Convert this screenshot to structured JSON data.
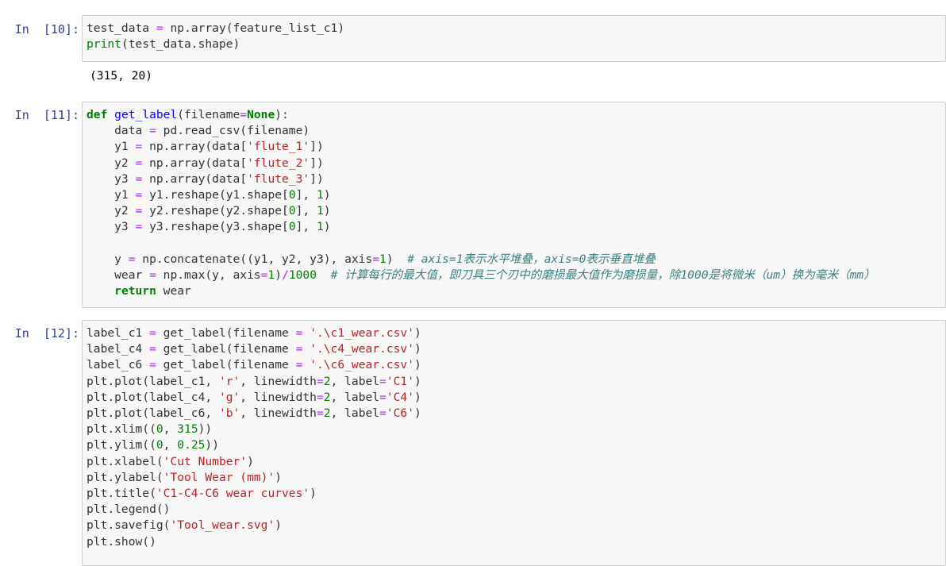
{
  "cells": [
    {
      "prompt": "In  [10]:",
      "lines": [
        [
          [
            "t",
            "test_data "
          ],
          [
            "op",
            "="
          ],
          [
            "t",
            " np.array(feature_list_c1)"
          ]
        ],
        [
          [
            "bi",
            "print"
          ],
          [
            "t",
            "(test_data.shape)"
          ]
        ]
      ],
      "output": "(315, 20)"
    },
    {
      "prompt": "In  [11]:",
      "lines": [
        [
          [
            "kw",
            "def"
          ],
          [
            "t",
            " "
          ],
          [
            "fn",
            "get_label"
          ],
          [
            "t",
            "(filename"
          ],
          [
            "op",
            "="
          ],
          [
            "kw",
            "None"
          ],
          [
            "t",
            "):"
          ]
        ],
        [
          [
            "t",
            "    data "
          ],
          [
            "op",
            "="
          ],
          [
            "t",
            " pd.read_csv(filename)"
          ]
        ],
        [
          [
            "t",
            "    y1 "
          ],
          [
            "op",
            "="
          ],
          [
            "t",
            " np.array(data["
          ],
          [
            "str",
            "'flute_1'"
          ],
          [
            "t",
            "])"
          ]
        ],
        [
          [
            "t",
            "    y2 "
          ],
          [
            "op",
            "="
          ],
          [
            "t",
            " np.array(data["
          ],
          [
            "str",
            "'flute_2'"
          ],
          [
            "t",
            "])"
          ]
        ],
        [
          [
            "t",
            "    y3 "
          ],
          [
            "op",
            "="
          ],
          [
            "t",
            " np.array(data["
          ],
          [
            "str",
            "'flute_3'"
          ],
          [
            "t",
            "])"
          ]
        ],
        [
          [
            "t",
            "    y1 "
          ],
          [
            "op",
            "="
          ],
          [
            "t",
            " y1.reshape(y1.shape["
          ],
          [
            "num",
            "0"
          ],
          [
            "t",
            "], "
          ],
          [
            "num",
            "1"
          ],
          [
            "t",
            ")"
          ]
        ],
        [
          [
            "t",
            "    y2 "
          ],
          [
            "op",
            "="
          ],
          [
            "t",
            " y2.reshape(y2.shape["
          ],
          [
            "num",
            "0"
          ],
          [
            "t",
            "], "
          ],
          [
            "num",
            "1"
          ],
          [
            "t",
            ")"
          ]
        ],
        [
          [
            "t",
            "    y3 "
          ],
          [
            "op",
            "="
          ],
          [
            "t",
            " y3.reshape(y3.shape["
          ],
          [
            "num",
            "0"
          ],
          [
            "t",
            "], "
          ],
          [
            "num",
            "1"
          ],
          [
            "t",
            ")"
          ]
        ],
        [],
        [
          [
            "t",
            "    y "
          ],
          [
            "op",
            "="
          ],
          [
            "t",
            " np.concatenate((y1, y2, y3), axis"
          ],
          [
            "op",
            "="
          ],
          [
            "num",
            "1"
          ],
          [
            "t",
            ")  "
          ],
          [
            "cm",
            "# axis=1表示水平堆叠，axis=0表示垂直堆叠"
          ]
        ],
        [
          [
            "t",
            "    wear "
          ],
          [
            "op",
            "="
          ],
          [
            "t",
            " np.max(y, axis"
          ],
          [
            "op",
            "="
          ],
          [
            "num",
            "1"
          ],
          [
            "t",
            ")"
          ],
          [
            "op",
            "/"
          ],
          [
            "num",
            "1000"
          ],
          [
            "t",
            "  "
          ],
          [
            "cm",
            "# 计算每行的最大值，即刀具三个刃中的磨损最大值作为磨损量，除1000是将微米（um）换为毫米（mm）"
          ]
        ],
        [
          [
            "t",
            "    "
          ],
          [
            "kw",
            "return"
          ],
          [
            "t",
            " wear"
          ]
        ]
      ]
    },
    {
      "prompt": "In  [12]:",
      "lines": [
        [
          [
            "t",
            "label_c1 "
          ],
          [
            "op",
            "="
          ],
          [
            "t",
            " get_label(filename "
          ],
          [
            "op",
            "="
          ],
          [
            "t",
            " "
          ],
          [
            "str",
            "'.\\c1_wear.csv'"
          ],
          [
            "t",
            ")"
          ]
        ],
        [
          [
            "t",
            "label_c4 "
          ],
          [
            "op",
            "="
          ],
          [
            "t",
            " get_label(filename "
          ],
          [
            "op",
            "="
          ],
          [
            "t",
            " "
          ],
          [
            "str",
            "'.\\c4_wear.csv'"
          ],
          [
            "t",
            ")"
          ]
        ],
        [
          [
            "t",
            "label_c6 "
          ],
          [
            "op",
            "="
          ],
          [
            "t",
            " get_label(filename "
          ],
          [
            "op",
            "="
          ],
          [
            "t",
            " "
          ],
          [
            "str",
            "'.\\c6_wear.csv'"
          ],
          [
            "t",
            ")"
          ]
        ],
        [
          [
            "t",
            "plt.plot(label_c1, "
          ],
          [
            "str",
            "'r'"
          ],
          [
            "t",
            ", linewidth"
          ],
          [
            "op",
            "="
          ],
          [
            "num",
            "2"
          ],
          [
            "t",
            ", label"
          ],
          [
            "op",
            "="
          ],
          [
            "str",
            "'C1'"
          ],
          [
            "t",
            ")"
          ]
        ],
        [
          [
            "t",
            "plt.plot(label_c4, "
          ],
          [
            "str",
            "'g'"
          ],
          [
            "t",
            ", linewidth"
          ],
          [
            "op",
            "="
          ],
          [
            "num",
            "2"
          ],
          [
            "t",
            ", label"
          ],
          [
            "op",
            "="
          ],
          [
            "str",
            "'C4'"
          ],
          [
            "t",
            ")"
          ]
        ],
        [
          [
            "t",
            "plt.plot(label_c6, "
          ],
          [
            "str",
            "'b'"
          ],
          [
            "t",
            ", linewidth"
          ],
          [
            "op",
            "="
          ],
          [
            "num",
            "2"
          ],
          [
            "t",
            ", label"
          ],
          [
            "op",
            "="
          ],
          [
            "str",
            "'C6'"
          ],
          [
            "t",
            ")"
          ]
        ],
        [
          [
            "t",
            "plt.xlim(("
          ],
          [
            "num",
            "0"
          ],
          [
            "t",
            ", "
          ],
          [
            "num",
            "315"
          ],
          [
            "t",
            "))"
          ]
        ],
        [
          [
            "t",
            "plt.ylim(("
          ],
          [
            "num",
            "0"
          ],
          [
            "t",
            ", "
          ],
          [
            "num",
            "0.25"
          ],
          [
            "t",
            "))"
          ]
        ],
        [
          [
            "t",
            "plt.xlabel("
          ],
          [
            "str",
            "'Cut Number'"
          ],
          [
            "t",
            ")"
          ]
        ],
        [
          [
            "t",
            "plt.ylabel("
          ],
          [
            "str",
            "'Tool Wear (mm)'"
          ],
          [
            "t",
            ")"
          ]
        ],
        [
          [
            "t",
            "plt.title("
          ],
          [
            "str",
            "'C1-C4-C6 wear curves'"
          ],
          [
            "t",
            ")"
          ]
        ],
        [
          [
            "t",
            "plt.legend()"
          ]
        ],
        [
          [
            "t",
            "plt.savefig("
          ],
          [
            "str",
            "'Tool_wear.svg'"
          ],
          [
            "t",
            ")"
          ]
        ],
        [
          [
            "t",
            "plt.show()"
          ]
        ]
      ]
    }
  ]
}
